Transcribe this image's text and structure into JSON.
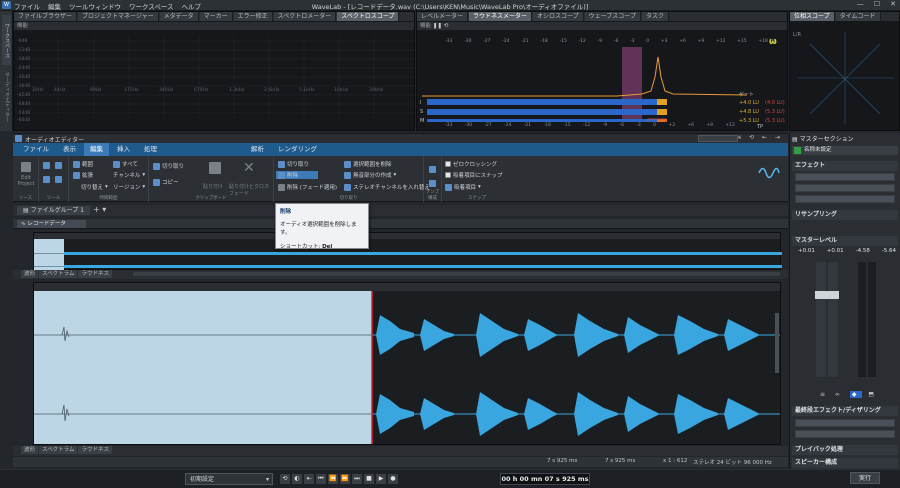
{
  "app": {
    "logo": "W",
    "title": "WaveLab - [レコードデータ.wav (C:\\Users\\KEN\\Music\\WaveLab Pro\\オーディオファイル)]",
    "menu": [
      "ファイル",
      "編集",
      "ツールウィンドウ",
      "ワークスペース",
      "ヘルプ"
    ]
  },
  "left_strip": {
    "labels": [
      "ワークスペース",
      "オーディオエディター"
    ]
  },
  "spectro_panel": {
    "tabs": [
      "ファイルブラウザー",
      "プロジェクトマネージャー",
      "メタデータ",
      "マーカー",
      "エラー修正",
      "スペクトロメーター",
      "スペクトロスコープ"
    ],
    "active_tab": 6,
    "sub_label": "機能",
    "y_labels": [
      "-6dB",
      "-12dB",
      "-18dB",
      "-24dB",
      "-30dB",
      "-36dB",
      "-42dB",
      "-48dB",
      "-54dB",
      "-60dB"
    ],
    "x_labels": [
      "20Hz",
      "44Hz",
      "89Hz",
      "175Hz",
      "340Hz",
      "670Hz",
      "1.3kHz",
      "2.6kHz",
      "5.1kHz",
      "10kHz",
      "20kHz"
    ]
  },
  "loud_panel": {
    "tabs": [
      "レベルメーター",
      "ラウドネスメーター",
      "オシロスコープ",
      "ウェーブスコープ",
      "タスク"
    ],
    "active_tab": 1,
    "sub_label": "機能",
    "scale": [
      "-33",
      "-30",
      "-27",
      "-24",
      "-21",
      "-18",
      "-15",
      "-12",
      "-9",
      "-6",
      "-3",
      "0",
      "+3",
      "+6",
      "+9",
      "+12",
      "+15",
      "+18 LU"
    ],
    "rows": [
      "I",
      "S",
      "M"
    ],
    "gate_label": "ゲート",
    "readouts": [
      {
        "val": "+4.0 LU",
        "peak": "(4.0 LU)"
      },
      {
        "val": "+4.8 LU",
        "peak": "(5.3 LU)"
      },
      {
        "val": "+5.3 LU",
        "peak": "(5.3 LU)"
      }
    ],
    "tp_label": "TP"
  },
  "phase_panel": {
    "tabs": [
      "位相スコープ",
      "タイムコード"
    ],
    "active_tab": 0,
    "sub_label": "L/R"
  },
  "editor": {
    "title": "オーディオエディター",
    "ribbon_tabs": [
      "ファイル",
      "表示",
      "編集",
      "挿入",
      "処理",
      "解析",
      "レンダリング"
    ],
    "active_ribbon_tab": 2,
    "groups": [
      {
        "label": "ソース",
        "items": [
          "Edit Project"
        ]
      },
      {
        "label": "ツール",
        "items": []
      },
      {
        "label": "時間範囲",
        "items": [
          "範囲",
          "すべて",
          "拡張",
          "チャンネル",
          "切り替え",
          "リージョン"
        ]
      },
      {
        "label": "クリップボード",
        "items": [
          "切り取り",
          "コピー",
          "貼り付け",
          "貼り付けとクロスフェード"
        ]
      },
      {
        "label": "切り取り",
        "items": [
          "切り取り",
          "削除",
          "削除 (フェード適用)",
          "選択範囲を削除",
          "無音部分の作成",
          "ステレオチャンネルを入れ替え"
        ]
      },
      {
        "label": "テンプ構成",
        "items": []
      },
      {
        "label": "スナップ",
        "items": [
          "ゼロクロッシング",
          "吸着項目にスナップ",
          "吸着項目"
        ]
      }
    ],
    "tooltip": {
      "title": "削除",
      "desc": "オーディオ選択範囲を削除します。",
      "shortcut_label": "ショートカット:",
      "shortcut": "Del"
    },
    "file_group": "ファイルグループ 1",
    "doc_tab": "レコードデータ",
    "view_tabs": [
      "波形",
      "スペクトラム",
      "ラウドネス"
    ],
    "status": {
      "pos1": "7 s 925 ms",
      "pos2": "7 s 925 ms",
      "zoom": "x 1 : 612",
      "format": "ステレオ 24 ビット 96 000 Hz"
    }
  },
  "master": {
    "title": "マスターセクション",
    "preset": "名称未設定",
    "effects_label": "エフェクト",
    "resampling_label": "リサンプリング",
    "level_label": "マスターレベル",
    "level_readout": [
      "+0.01",
      "+0.01",
      "-4.58",
      "-5.64"
    ],
    "final_label": "最終段エフェクト/ディザリング",
    "playback_label": "プレイバック処理",
    "speaker_label": "スピーカー構成",
    "render_button": "実行"
  },
  "transport": {
    "preset": "初期設定",
    "time": "00 h 00 mn 07 s 925 ms"
  },
  "colors": {
    "accent": "#1f5a8c",
    "wave": "#3aa6e0",
    "selection": "#bcd6e6",
    "cursor": "#e02030"
  }
}
